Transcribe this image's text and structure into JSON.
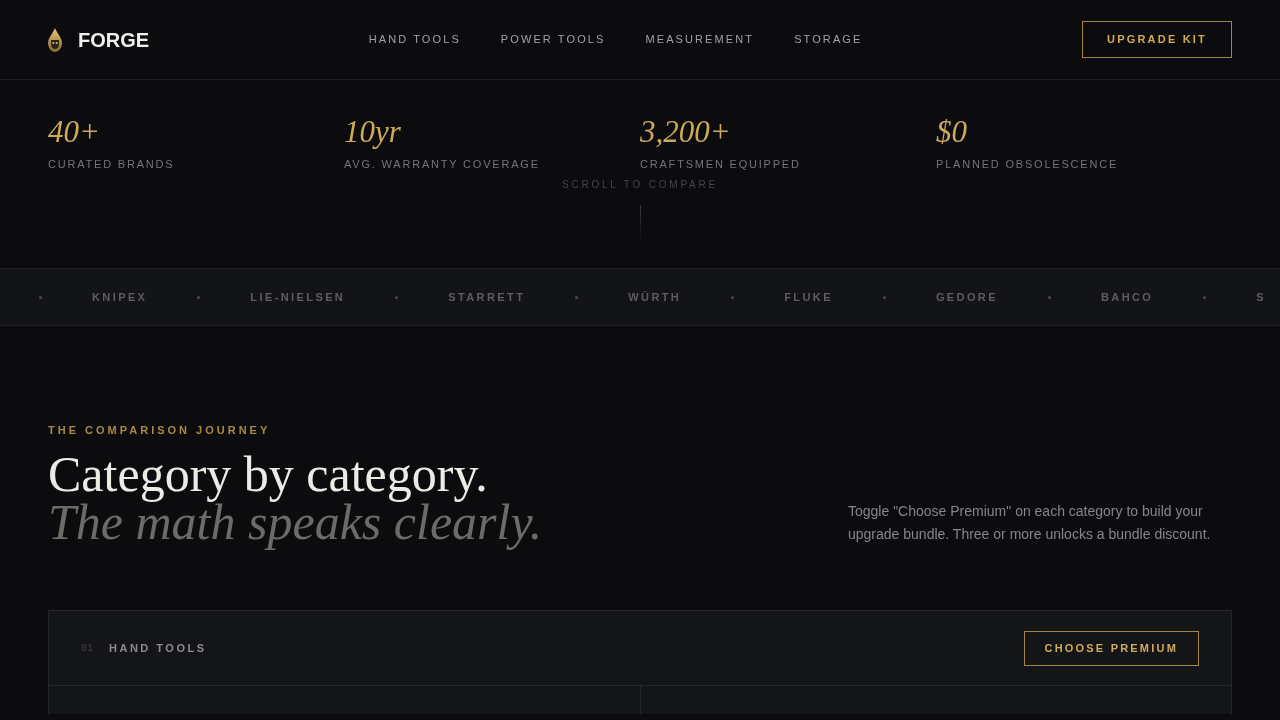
{
  "header": {
    "brand": "FORGE",
    "nav": [
      {
        "label": "HAND TOOLS"
      },
      {
        "label": "POWER TOOLS"
      },
      {
        "label": "MEASUREMENT"
      },
      {
        "label": "STORAGE"
      }
    ],
    "cta": "UPGRADE KIT"
  },
  "stats": [
    {
      "value": "40+",
      "label": "CURATED BRANDS"
    },
    {
      "value": "10yr",
      "label": "AVG. WARRANTY COVERAGE"
    },
    {
      "value": "3,200+",
      "label": "CRAFTSMEN EQUIPPED"
    },
    {
      "value": "$0",
      "label": "PLANNED OBSOLESCENCE"
    }
  ],
  "scroll_hint": "SCROLL TO COMPARE",
  "brands": [
    "KNIPEX",
    "LIE-NIELSEN",
    "STARRETT",
    "WÜRTH",
    "FLUKE",
    "GEDORE",
    "BAHCO",
    "S"
  ],
  "journey": {
    "eyebrow": "THE COMPARISON JOURNEY",
    "title": "Category by category.",
    "subtitle": "The math speaks clearly.",
    "description": "Toggle \"Choose Premium\" on each category to build your upgrade bundle. Three or more unlocks a bundle discount."
  },
  "categories": [
    {
      "number": "01",
      "name": "HAND TOOLS",
      "button": "CHOOSE PREMIUM",
      "chosen": false
    }
  ]
}
